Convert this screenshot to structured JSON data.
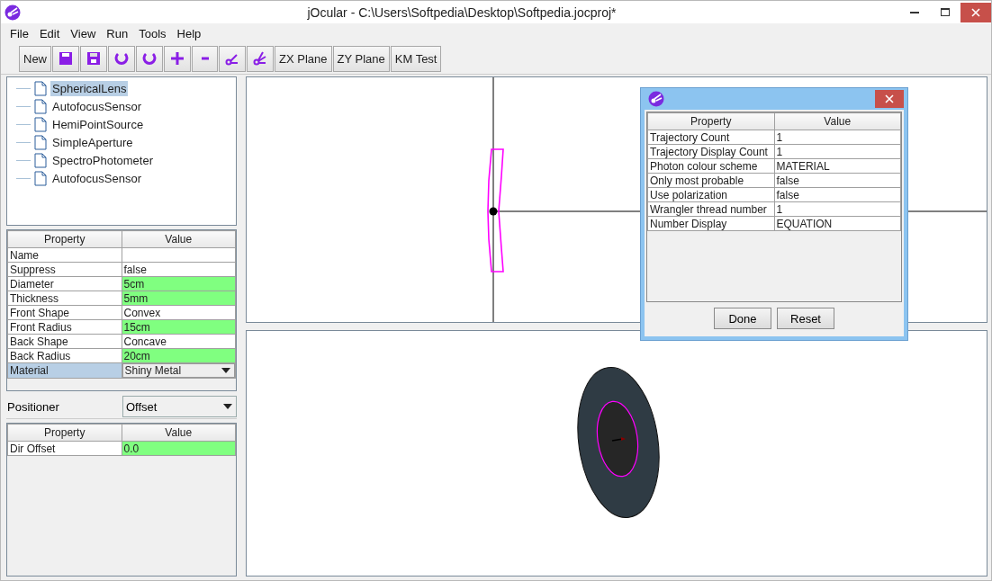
{
  "window": {
    "title": "jOcular - C:\\Users\\Softpedia\\Desktop\\Softpedia.jocproj*"
  },
  "menu": [
    "File",
    "Edit",
    "View",
    "Run",
    "Tools",
    "Help"
  ],
  "toolbar": [
    {
      "kind": "text",
      "label": "New"
    },
    {
      "kind": "icon"
    },
    {
      "kind": "icon"
    },
    {
      "kind": "icon"
    },
    {
      "kind": "icon"
    },
    {
      "kind": "icon"
    },
    {
      "kind": "icon"
    },
    {
      "kind": "icon"
    },
    {
      "kind": "icon"
    },
    {
      "kind": "text",
      "label": "ZX Plane"
    },
    {
      "kind": "text",
      "label": "ZY Plane"
    },
    {
      "kind": "text",
      "label": "KM Test"
    }
  ],
  "tree": [
    {
      "label": "SphericalLens",
      "selected": true
    },
    {
      "label": "AutofocusSensor",
      "selected": false
    },
    {
      "label": "HemiPointSource",
      "selected": false
    },
    {
      "label": "SimpleAperture",
      "selected": false
    },
    {
      "label": "SpectroPhotometer",
      "selected": false
    },
    {
      "label": "AutofocusSensor",
      "selected": false
    }
  ],
  "properties": {
    "columns": [
      "Property",
      "Value"
    ],
    "rows": [
      {
        "name": "Name",
        "value": "",
        "kind": "text",
        "highlighted": false,
        "selected": false
      },
      {
        "name": "Suppress",
        "value": "false",
        "kind": "text",
        "highlighted": false,
        "selected": false
      },
      {
        "name": "Diameter",
        "value": "5cm",
        "kind": "text",
        "highlighted": true,
        "selected": false
      },
      {
        "name": "Thickness",
        "value": "5mm",
        "kind": "text",
        "highlighted": true,
        "selected": false
      },
      {
        "name": "Front Shape",
        "value": "Convex",
        "kind": "text",
        "highlighted": false,
        "selected": false
      },
      {
        "name": "Front Radius",
        "value": "15cm",
        "kind": "text",
        "highlighted": true,
        "selected": false
      },
      {
        "name": "Back Shape",
        "value": "Concave",
        "kind": "text",
        "highlighted": false,
        "selected": false
      },
      {
        "name": "Back Radius",
        "value": "20cm",
        "kind": "text",
        "highlighted": true,
        "selected": false
      },
      {
        "name": "Material",
        "value": "Shiny Metal",
        "kind": "dropdown",
        "highlighted": false,
        "selected": true
      }
    ]
  },
  "positioner": {
    "label": "Positioner",
    "value": "Offset"
  },
  "offset_table": {
    "columns": [
      "Property",
      "Value"
    ],
    "rows": [
      {
        "name": "Dir Offset",
        "value": "0.0",
        "highlighted": true,
        "selected": false
      }
    ]
  },
  "dialog": {
    "columns": [
      "Property",
      "Value"
    ],
    "rows": [
      {
        "name": "Trajectory Count",
        "value": "1"
      },
      {
        "name": "Trajectory Display Count",
        "value": "1"
      },
      {
        "name": "Photon colour scheme",
        "value": "MATERIAL"
      },
      {
        "name": "Only most probable",
        "value": "false"
      },
      {
        "name": "Use polarization",
        "value": "false"
      },
      {
        "name": "Wrangler thread number",
        "value": "1"
      },
      {
        "name": "Number Display",
        "value": "EQUATION"
      }
    ],
    "buttons": [
      "Done",
      "Reset"
    ]
  }
}
